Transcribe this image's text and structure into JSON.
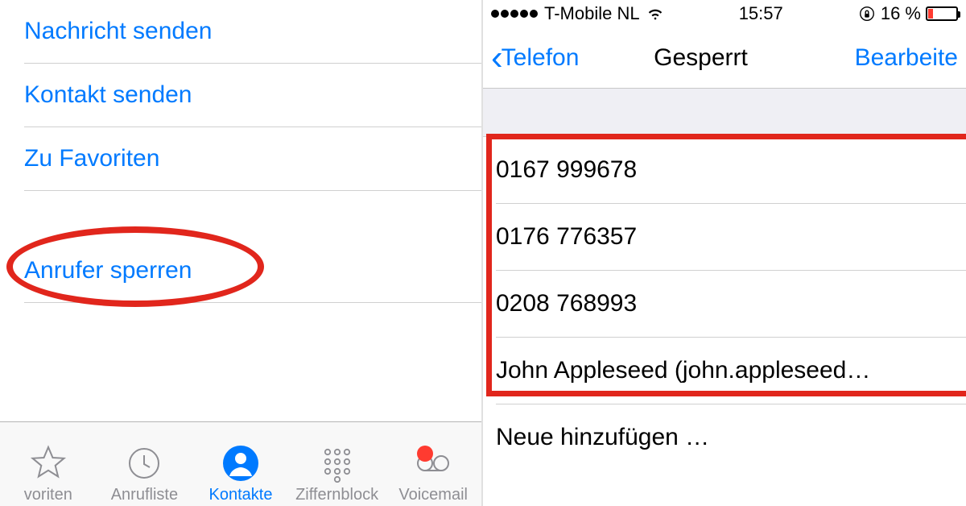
{
  "left": {
    "actions": {
      "send_message": "Nachricht senden",
      "send_contact": "Kontakt senden",
      "to_favorites": "Zu Favoriten",
      "block_caller": "Anrufer sperren"
    },
    "tabs": {
      "favorites": "voriten",
      "recents": "Anrufliste",
      "contacts": "Kontakte",
      "keypad": "Ziffernblock",
      "voicemail": "Voicemail"
    }
  },
  "right": {
    "status": {
      "carrier": "T-Mobile NL",
      "time": "15:57",
      "battery": "16 %"
    },
    "nav": {
      "back": "Telefon",
      "title": "Gesperrt",
      "edit": "Bearbeite"
    },
    "blocked": [
      "0167 999678",
      "0176 776357",
      "0208 768993",
      "John Appleseed (john.appleseed…"
    ],
    "add_new": "Neue hinzufügen …"
  }
}
